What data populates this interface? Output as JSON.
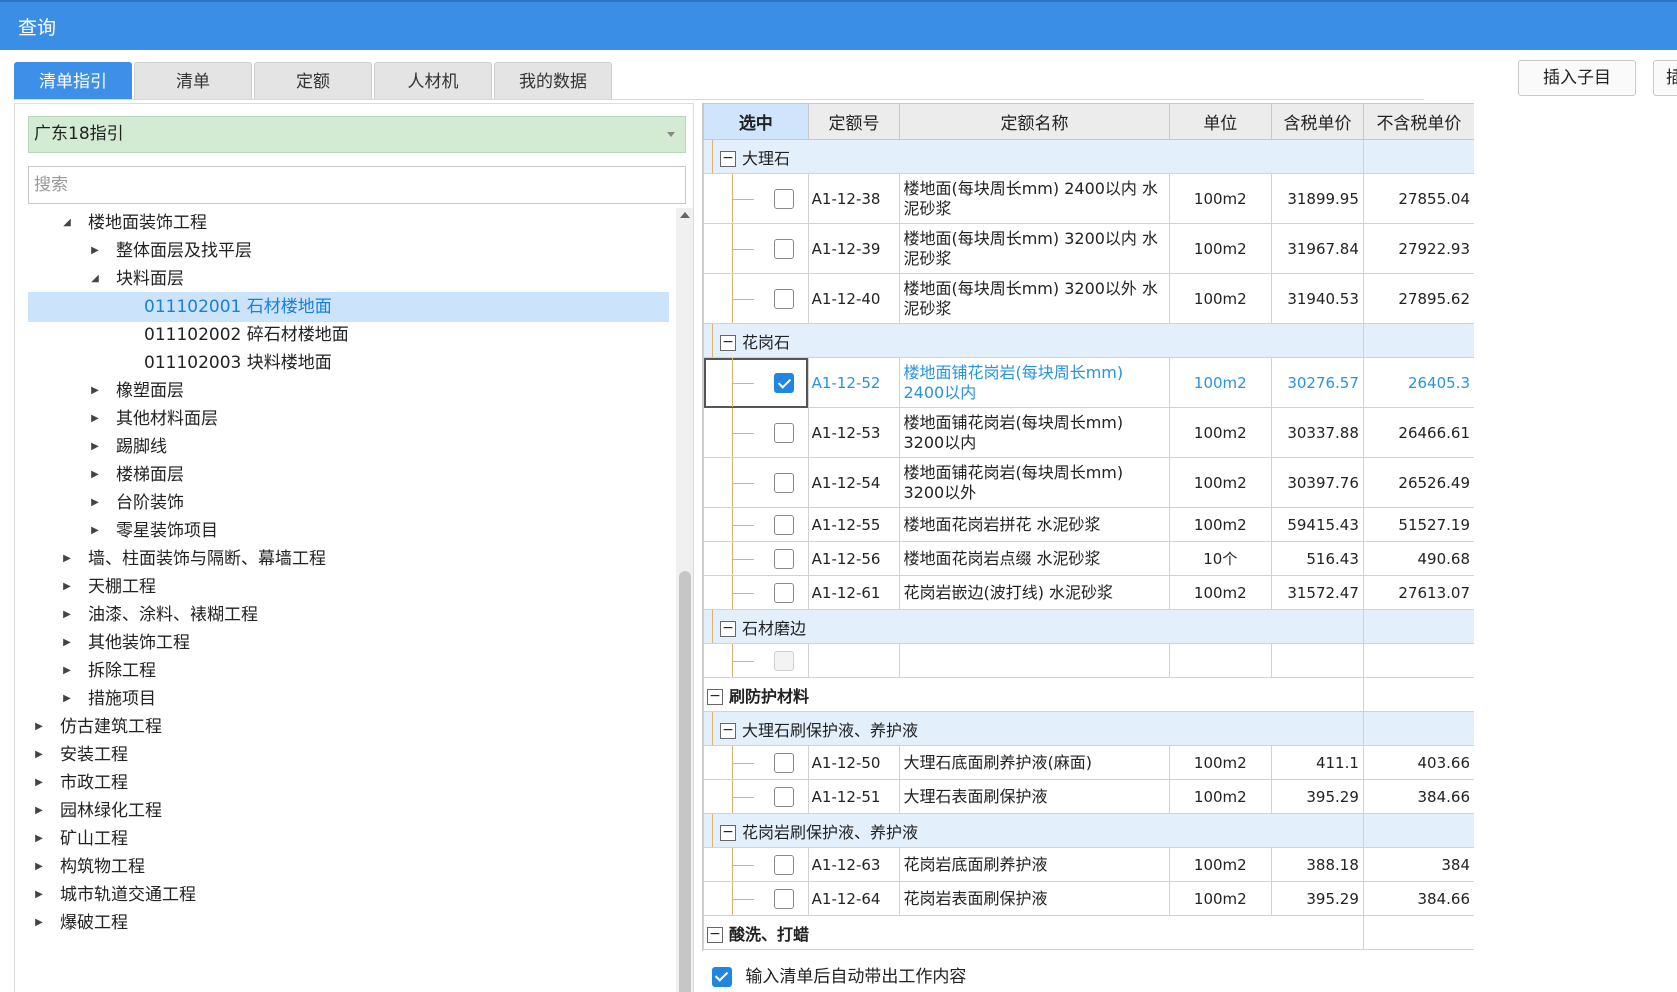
{
  "window": {
    "title": "查询"
  },
  "tabs": [
    "清单指引",
    "清单",
    "定额",
    "人材机",
    "我的数据"
  ],
  "toolbar": {
    "insert_child": "插入子目",
    "insert_partial": "插"
  },
  "left": {
    "dropdown": "广东18指引",
    "search_placeholder": "搜索",
    "tree": [
      {
        "label": "楼地面装饰工程",
        "level": 1,
        "arrow": "▲"
      },
      {
        "label": "整体面层及找平层",
        "level": 2,
        "arrow": "▶"
      },
      {
        "label": "块料面层",
        "level": 2,
        "arrow": "▲"
      },
      {
        "label": "011102001   石材楼地面",
        "level": 3,
        "arrow": "",
        "selected": true
      },
      {
        "label": "011102002   碎石材楼地面",
        "level": 3,
        "arrow": ""
      },
      {
        "label": "011102003   块料楼地面",
        "level": 3,
        "arrow": ""
      },
      {
        "label": "橡塑面层",
        "level": 2,
        "arrow": "▶"
      },
      {
        "label": "其他材料面层",
        "level": 2,
        "arrow": "▶"
      },
      {
        "label": "踢脚线",
        "level": 2,
        "arrow": "▶"
      },
      {
        "label": "楼梯面层",
        "level": 2,
        "arrow": "▶"
      },
      {
        "label": "台阶装饰",
        "level": 2,
        "arrow": "▶"
      },
      {
        "label": "零星装饰项目",
        "level": 2,
        "arrow": "▶"
      },
      {
        "label": "墙、柱面装饰与隔断、幕墙工程",
        "level": 1,
        "arrow": "▶"
      },
      {
        "label": "天棚工程",
        "level": 1,
        "arrow": "▶"
      },
      {
        "label": "油漆、涂料、裱糊工程",
        "level": 1,
        "arrow": "▶"
      },
      {
        "label": "其他装饰工程",
        "level": 1,
        "arrow": "▶"
      },
      {
        "label": "拆除工程",
        "level": 1,
        "arrow": "▶"
      },
      {
        "label": "措施项目",
        "level": 1,
        "arrow": "▶"
      },
      {
        "label": "仿古建筑工程",
        "level": 0,
        "arrow": "▶"
      },
      {
        "label": "安装工程",
        "level": 0,
        "arrow": "▶"
      },
      {
        "label": "市政工程",
        "level": 0,
        "arrow": "▶"
      },
      {
        "label": "园林绿化工程",
        "level": 0,
        "arrow": "▶"
      },
      {
        "label": "矿山工程",
        "level": 0,
        "arrow": "▶"
      },
      {
        "label": "构筑物工程",
        "level": 0,
        "arrow": "▶"
      },
      {
        "label": "城市轨道交通工程",
        "level": 0,
        "arrow": "▶"
      },
      {
        "label": "爆破工程",
        "level": 0,
        "arrow": "▶"
      }
    ]
  },
  "grid": {
    "headers": [
      "选中",
      "定额号",
      "定额名称",
      "单位",
      "含税单价",
      "不含税单价"
    ],
    "rows": [
      {
        "kind": "group",
        "label": "大理石"
      },
      {
        "kind": "item",
        "checked": false,
        "code": "A1-12-38",
        "name": "楼地面(每块周长mm) 2400以内 水泥砂浆",
        "unit": "100m2",
        "price_tax": "31899.95",
        "price_notax": "27855.04"
      },
      {
        "kind": "item",
        "checked": false,
        "code": "A1-12-39",
        "name": "楼地面(每块周长mm) 3200以内 水泥砂浆",
        "unit": "100m2",
        "price_tax": "31967.84",
        "price_notax": "27922.93"
      },
      {
        "kind": "item",
        "checked": false,
        "code": "A1-12-40",
        "name": "楼地面(每块周长mm) 3200以外 水泥砂浆",
        "unit": "100m2",
        "price_tax": "31940.53",
        "price_notax": "27895.62"
      },
      {
        "kind": "group",
        "label": "花岗石"
      },
      {
        "kind": "item",
        "checked": true,
        "highlight": true,
        "code": "A1-12-52",
        "name": "楼地面铺花岗岩(每块周长mm) 2400以内",
        "unit": "100m2",
        "price_tax": "30276.57",
        "price_notax": "26405.3"
      },
      {
        "kind": "item",
        "checked": false,
        "code": "A1-12-53",
        "name": "楼地面铺花岗岩(每块周长mm) 3200以内",
        "unit": "100m2",
        "price_tax": "30337.88",
        "price_notax": "26466.61"
      },
      {
        "kind": "item",
        "checked": false,
        "code": "A1-12-54",
        "name": "楼地面铺花岗岩(每块周长mm) 3200以外",
        "unit": "100m2",
        "price_tax": "30397.76",
        "price_notax": "26526.49"
      },
      {
        "kind": "item1",
        "checked": false,
        "code": "A1-12-55",
        "name": "楼地面花岗岩拼花 水泥砂浆",
        "unit": "100m2",
        "price_tax": "59415.43",
        "price_notax": "51527.19"
      },
      {
        "kind": "item1",
        "checked": false,
        "code": "A1-12-56",
        "name": "楼地面花岗岩点缀 水泥砂浆",
        "unit": "10个",
        "price_tax": "516.43",
        "price_notax": "490.68"
      },
      {
        "kind": "item1",
        "checked": false,
        "code": "A1-12-61",
        "name": "花岗岩嵌边(波打线) 水泥砂浆",
        "unit": "100m2",
        "price_tax": "31572.47",
        "price_notax": "27613.07"
      },
      {
        "kind": "group",
        "label": "石材磨边"
      },
      {
        "kind": "empty"
      },
      {
        "kind": "topgroup",
        "label": "刷防护材料"
      },
      {
        "kind": "group",
        "label": "大理石刷保护液、养护液"
      },
      {
        "kind": "item1",
        "checked": false,
        "code": "A1-12-50",
        "name": "大理石底面刷养护液(麻面)",
        "unit": "100m2",
        "price_tax": "411.1",
        "price_notax": "403.66"
      },
      {
        "kind": "item1",
        "checked": false,
        "code": "A1-12-51",
        "name": "大理石表面刷保护液",
        "unit": "100m2",
        "price_tax": "395.29",
        "price_notax": "384.66"
      },
      {
        "kind": "group",
        "label": "花岗岩刷保护液、养护液"
      },
      {
        "kind": "item1",
        "checked": false,
        "code": "A1-12-63",
        "name": "花岗岩底面刷养护液",
        "unit": "100m2",
        "price_tax": "388.18",
        "price_notax": "384"
      },
      {
        "kind": "item1",
        "checked": false,
        "code": "A1-12-64",
        "name": "花岗岩表面刷保护液",
        "unit": "100m2",
        "price_tax": "395.29",
        "price_notax": "384.66"
      },
      {
        "kind": "topgroup",
        "label": "酸洗、打蜡"
      }
    ]
  },
  "bottom": {
    "option": "输入清单后自动带出工作内容",
    "checked": true
  }
}
